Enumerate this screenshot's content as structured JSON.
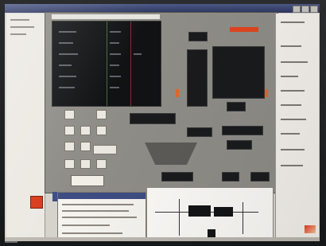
{
  "window": {},
  "left_pane": {},
  "instrument": {},
  "dialog": {},
  "schematic": {},
  "right_pane": {},
  "colors": {
    "title_bar": "#2c3560",
    "instrument_body": "#8f8d87",
    "display_background": "#101214",
    "brand_accent": "#e0451f",
    "alert_square": "#d93a1a"
  }
}
